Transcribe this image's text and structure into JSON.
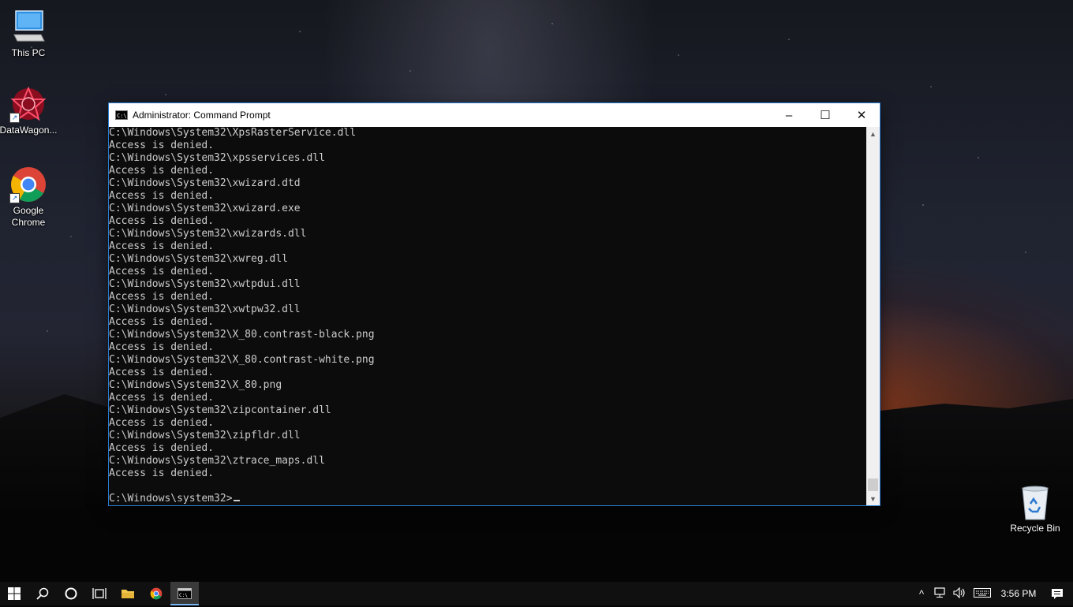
{
  "desktop": {
    "icons": [
      {
        "label": "This PC"
      },
      {
        "label": "DataWagon..."
      },
      {
        "label": "Google\nChrome"
      },
      {
        "label": "Recycle Bin"
      }
    ]
  },
  "window": {
    "title": "Administrator: Command Prompt",
    "icon_text": "C:\\",
    "controls": {
      "minimize": "–",
      "maximize": "☐",
      "close": "✕"
    }
  },
  "console": {
    "lines": [
      "C:\\Windows\\System32\\XpsRasterService.dll",
      "Access is denied.",
      "C:\\Windows\\System32\\xpsservices.dll",
      "Access is denied.",
      "C:\\Windows\\System32\\xwizard.dtd",
      "Access is denied.",
      "C:\\Windows\\System32\\xwizard.exe",
      "Access is denied.",
      "C:\\Windows\\System32\\xwizards.dll",
      "Access is denied.",
      "C:\\Windows\\System32\\xwreg.dll",
      "Access is denied.",
      "C:\\Windows\\System32\\xwtpdui.dll",
      "Access is denied.",
      "C:\\Windows\\System32\\xwtpw32.dll",
      "Access is denied.",
      "C:\\Windows\\System32\\X_80.contrast-black.png",
      "Access is denied.",
      "C:\\Windows\\System32\\X_80.contrast-white.png",
      "Access is denied.",
      "C:\\Windows\\System32\\X_80.png",
      "Access is denied.",
      "C:\\Windows\\System32\\zipcontainer.dll",
      "Access is denied.",
      "C:\\Windows\\System32\\zipfldr.dll",
      "Access is denied.",
      "C:\\Windows\\System32\\ztrace_maps.dll",
      "Access is denied.",
      ""
    ],
    "prompt": "C:\\Windows\\system32>"
  },
  "scrollbar": {
    "up": "▲",
    "down": "▼"
  },
  "taskbar": {
    "icons": [
      "windows-start-icon",
      "search-icon",
      "cortana-icon",
      "task-view-icon",
      "file-explorer-icon",
      "chrome-icon",
      "command-prompt-icon"
    ],
    "tray": {
      "chevron": "^",
      "time": "3:56 PM"
    }
  }
}
